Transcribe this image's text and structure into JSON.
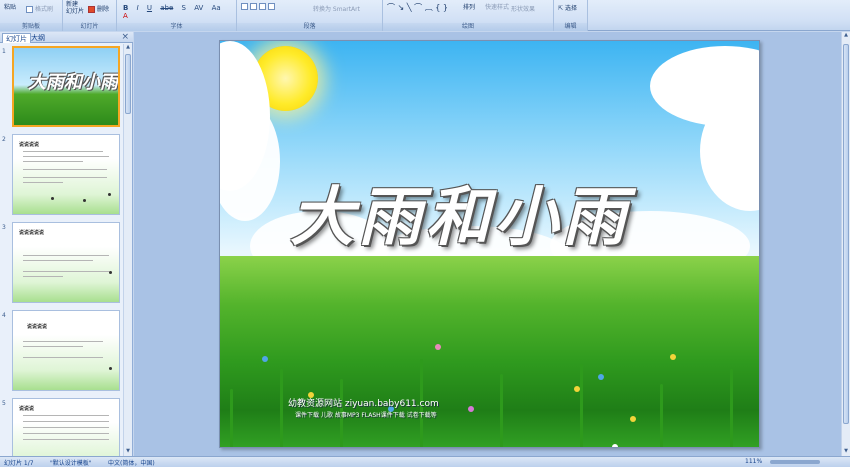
{
  "ribbon": {
    "clipboard": {
      "paste_label": "粘贴",
      "format_painter_label": "格式刷",
      "group_label": "剪贴板"
    },
    "slides": {
      "new_slide_label": "新建\n幻灯片",
      "delete_label": "删除",
      "group_label": "幻灯片"
    },
    "font": {
      "group_label": "字体",
      "buttons": [
        "B",
        "I",
        "U",
        "abe",
        "S",
        "AV",
        "Aa",
        "A"
      ]
    },
    "paragraph": {
      "group_label": "段落",
      "smartart_label": "转换为 SmartArt"
    },
    "drawing": {
      "group_label": "绘图",
      "arrange_label": "排列",
      "quick_styles_label": "快速样式",
      "shape_effects_label": "形状效果"
    },
    "editing": {
      "group_label": "编辑",
      "select_label": "选择"
    }
  },
  "panel": {
    "tabs": [
      "幻灯片",
      "大纲"
    ],
    "close_glyph": "×",
    "slide_numbers": [
      "1",
      "2",
      "3",
      "4",
      "5"
    ],
    "thumb1_title": "大雨和小雨",
    "thumb_headings": [
      "说说说说",
      "说说说说说",
      "说说说说",
      "说说说"
    ]
  },
  "slide": {
    "title": "大雨和小雨",
    "watermark_line1": "幼教资源网站 ziyuan.baby611.com",
    "watermark_line2": "课件下载    儿歌 故事MP3    FLASH课件下载    试卷下载等"
  },
  "status": {
    "slide_index": "幻灯片 1/7",
    "theme": "\"默认设计模板\"",
    "language": "中文(简体，中国)",
    "zoom": "111%"
  },
  "colors": {
    "ribbon_bg": "#d1e0f5",
    "selected_thumb_border": "#f5a623",
    "canvas_bg": "#a9c2e5"
  }
}
